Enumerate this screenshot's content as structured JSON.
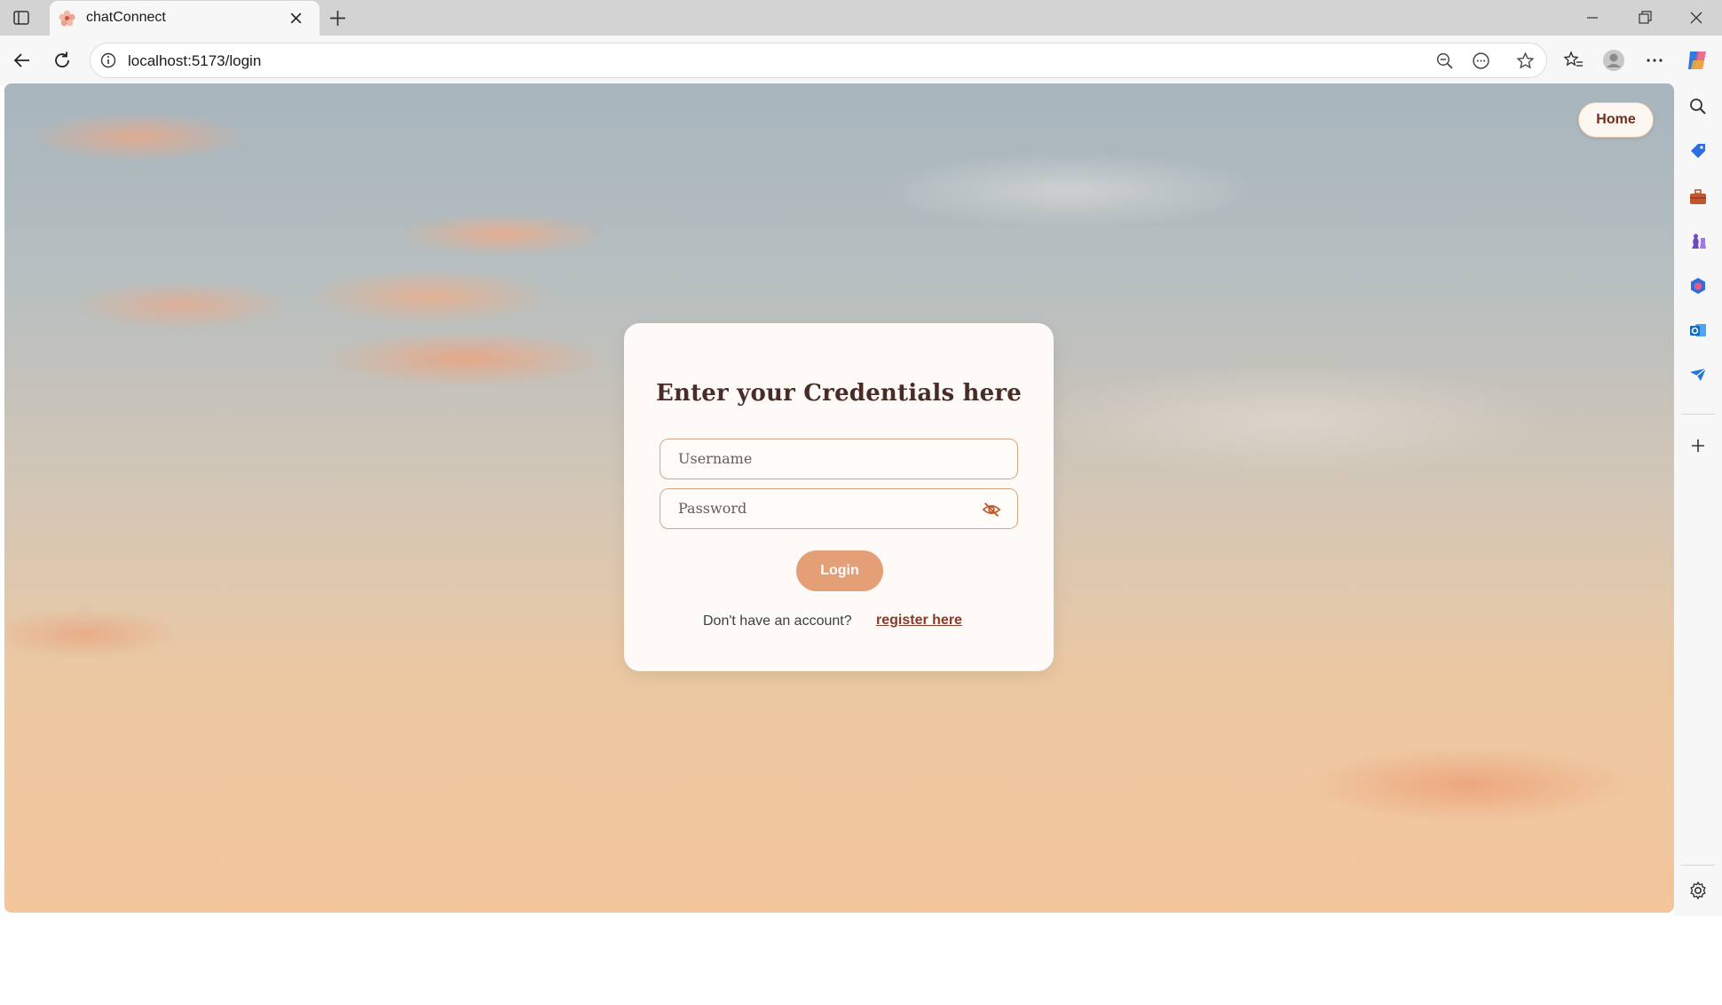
{
  "browser": {
    "tab": {
      "title": "chatConnect"
    },
    "address": {
      "url": "localhost:5173/login"
    }
  },
  "page": {
    "nav": {
      "home_label": "Home"
    },
    "login_card": {
      "title": "Enter your Credentials here",
      "username_placeholder": "Username",
      "password_placeholder": "Password",
      "login_label": "Login",
      "no_account_text": "Don't have an account?",
      "register_link": "register here"
    }
  },
  "colors": {
    "accent": "#e49f76",
    "title_text": "#4a2c27",
    "link": "#8a3a2a",
    "card_bg": "#fdfaf7"
  },
  "icons": {
    "password_toggle": "eye-off-icon"
  }
}
